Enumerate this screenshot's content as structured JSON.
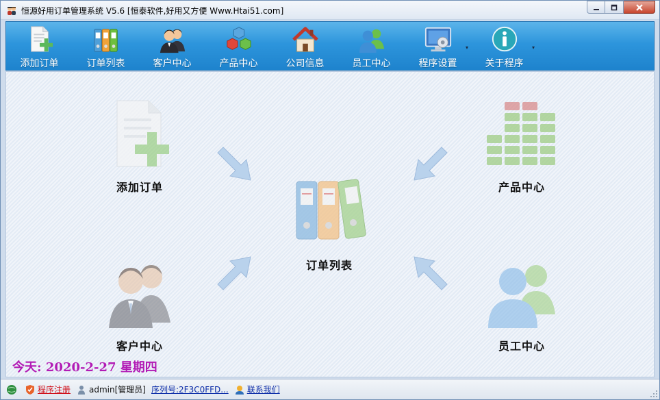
{
  "window": {
    "title": "恒源好用订单管理系统 V5.6  [恒泰软件,好用又方便 Www.Htai51.com]",
    "close_glyph": "✕",
    "maximize_glyph": "□",
    "minimize_glyph": "—"
  },
  "toolbar": {
    "items": [
      {
        "label": "添加订单",
        "icon": "add-order-icon"
      },
      {
        "label": "订单列表",
        "icon": "binders-icon"
      },
      {
        "label": "客户中心",
        "icon": "customers-icon"
      },
      {
        "label": "产品中心",
        "icon": "cubes-icon"
      },
      {
        "label": "公司信息",
        "icon": "house-icon"
      },
      {
        "label": "员工中心",
        "icon": "staff-icon"
      },
      {
        "label": "程序设置",
        "icon": "settings-monitor-icon",
        "dropdown": "▾"
      },
      {
        "label": "关于程序",
        "icon": "info-icon",
        "dropdown": "▾"
      }
    ]
  },
  "main": {
    "modules": {
      "add_order": "添加订单",
      "order_list": "订单列表",
      "product_center": "产品中心",
      "customer_center": "客户中心",
      "staff_center": "员工中心"
    },
    "date_text": "今天:  2020-2-27  星期四"
  },
  "statusbar": {
    "register": "程序注册",
    "user": "admin[管理员]",
    "serial": "序列号:2F3C0FFD...",
    "contact": "联系我们"
  },
  "colors": {
    "toolbar_top": "#5cb4ea",
    "toolbar_bottom": "#1e83cd",
    "date_text": "#b21bb5",
    "register_link": "#d0101a",
    "link_blue": "#0e2ea8"
  }
}
